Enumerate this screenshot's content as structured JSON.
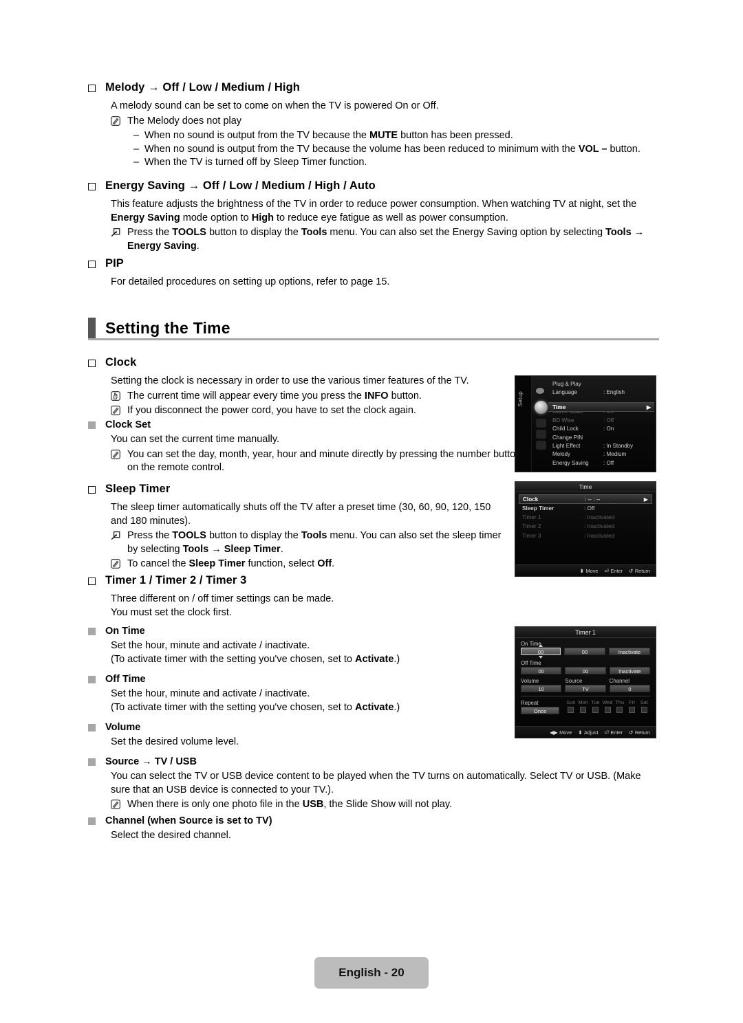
{
  "sections": {
    "melody": {
      "heading": "Melody → Off / Low / Medium / High",
      "intro": "A melody sound can be set to come on when the TV is powered On or Off.",
      "note": "The Melody does not play",
      "dashes": [
        "When no sound is output from the TV because the MUTE button has been pressed.",
        "When no sound is output from the TV because the volume has been reduced to minimum with the VOL – button.",
        "When the TV is turned off by Sleep Timer function."
      ],
      "dash_char": "–"
    },
    "energy_saving": {
      "heading": "Energy Saving → Off / Low / Medium / High / Auto",
      "body": "This feature adjusts the brightness of the TV in order to reduce power consumption. When watching TV at night, set the Energy Saving mode option to High to reduce eye fatigue as well as power consumption.",
      "tools_note": "Press the TOOLS button to display the Tools menu. You can also set the Energy Saving option by selecting Tools → Energy Saving."
    },
    "pip": {
      "heading": "PIP",
      "body": "For detailed procedures on setting up options, refer to page 15."
    },
    "setting_the_time": {
      "title": "Setting the Time"
    },
    "clock": {
      "heading": "Clock",
      "body": "Setting the clock is necessary in order to use the various timer features of the TV.",
      "note_info": "The current time will appear every time you press the INFO button.",
      "note_cord": "If you disconnect the power cord, you have to set the clock again.",
      "clock_set": {
        "heading": "Clock Set",
        "body": "You can set the current time manually.",
        "note": "You can set the day, month, year, hour and minute directly by pressing the number buttons on the remote control."
      }
    },
    "sleep_timer": {
      "heading": "Sleep Timer",
      "body": "The sleep timer automatically shuts off the TV after a preset time (30, 60, 90, 120, 150 and 180 minutes).",
      "tools_note": "Press the TOOLS button to display the Tools menu. You can also set the sleep timer by selecting Tools → Sleep Timer.",
      "cancel_note": "To cancel the Sleep Timer function, select Off."
    },
    "timers": {
      "heading": "Timer 1 / Timer 2 / Timer 3",
      "body_line1": "Three different on / off timer settings can be made.",
      "body_line2": "You must set the clock first.",
      "on_time": {
        "heading": "On Time",
        "line1": "Set the hour, minute and activate / inactivate.",
        "line2": "(To activate timer with the setting you've chosen, set to Activate.)"
      },
      "off_time": {
        "heading": "Off Time",
        "line1": "Set the hour, minute and activate / inactivate.",
        "line2": "(To activate timer with the setting you've chosen, set to Activate.)"
      },
      "volume": {
        "heading": "Volume",
        "line1": "Set the desired volume level."
      },
      "source": {
        "heading": "Source → TV / USB",
        "body": "You can select the TV or USB device content to be played when the TV turns on automatically. Select TV or USB. (Make sure that an USB device is connected to your TV.).",
        "note": "When there is only one photo file in the USB, the Slide Show will not play."
      },
      "channel": {
        "heading": "Channel (when Source is set to TV)",
        "line1": "Select the desired channel."
      }
    }
  },
  "osd_setup": {
    "rail_label": "Setup",
    "rows_top": [
      {
        "name": "Plug & Play",
        "value": ""
      },
      {
        "name": "Language",
        "value": ": English"
      }
    ],
    "selected": {
      "name": "Time",
      "arrow": "▶"
    },
    "rows_bottom": [
      {
        "name": "Game Mode",
        "value": ": Off",
        "dim": true
      },
      {
        "name": "BD Wise",
        "value": ": Off",
        "dim": true
      },
      {
        "name": "Child Lock",
        "value": ": On",
        "dim": false
      },
      {
        "name": "Change PIN",
        "value": "",
        "dim": false
      },
      {
        "name": "Light Effect",
        "value": ": In Standby",
        "dim": false
      },
      {
        "name": "Melody",
        "value": ": Medium",
        "dim": false
      },
      {
        "name": "Energy Saving",
        "value": ": Off",
        "dim": false
      }
    ]
  },
  "osd_time": {
    "title": "Time",
    "rows": [
      {
        "name": "Clock",
        "value": ": -- : --",
        "selected": true,
        "dim": false,
        "arrow": "▶"
      },
      {
        "name": "Sleep Timer",
        "value": ": Off",
        "selected": false,
        "dim": false
      },
      {
        "name": "Timer 1",
        "value": ": Inactivated",
        "selected": false,
        "dim": true
      },
      {
        "name": "Timer 2",
        "value": ": Inactivated",
        "selected": false,
        "dim": true
      },
      {
        "name": "Timer 3",
        "value": ": Inactivated",
        "selected": false,
        "dim": true
      }
    ],
    "nav": [
      {
        "glyph": "⬍",
        "label": "Move"
      },
      {
        "glyph": "⏎",
        "label": "Enter"
      },
      {
        "glyph": "↺",
        "label": "Return"
      }
    ]
  },
  "osd_timer": {
    "title": "Timer 1",
    "on_time_label": "On Time",
    "on_time": {
      "hour": "00",
      "minute": "00",
      "state": "Inactivate"
    },
    "off_time_label": "Off Time",
    "off_time": {
      "hour": "00",
      "minute": "00",
      "state": "Inactivate"
    },
    "volume_label": "Volume",
    "source_label": "Source",
    "channel_label": "Channel",
    "volume_value": "10",
    "source_value": "TV",
    "channel_value": "0",
    "repeat_label": "Repeat",
    "repeat_value": "Once",
    "days": [
      "Sun",
      "Mon",
      "Tue",
      "Wed",
      "Thu",
      "Fri",
      "Sat"
    ],
    "nav": [
      {
        "glyph": "◀▶",
        "label": "Move"
      },
      {
        "glyph": "⬍",
        "label": "Adjust"
      },
      {
        "glyph": "⏎",
        "label": "Enter"
      },
      {
        "glyph": "↺",
        "label": "Return"
      }
    ]
  },
  "footer": {
    "label": "English - 20"
  }
}
